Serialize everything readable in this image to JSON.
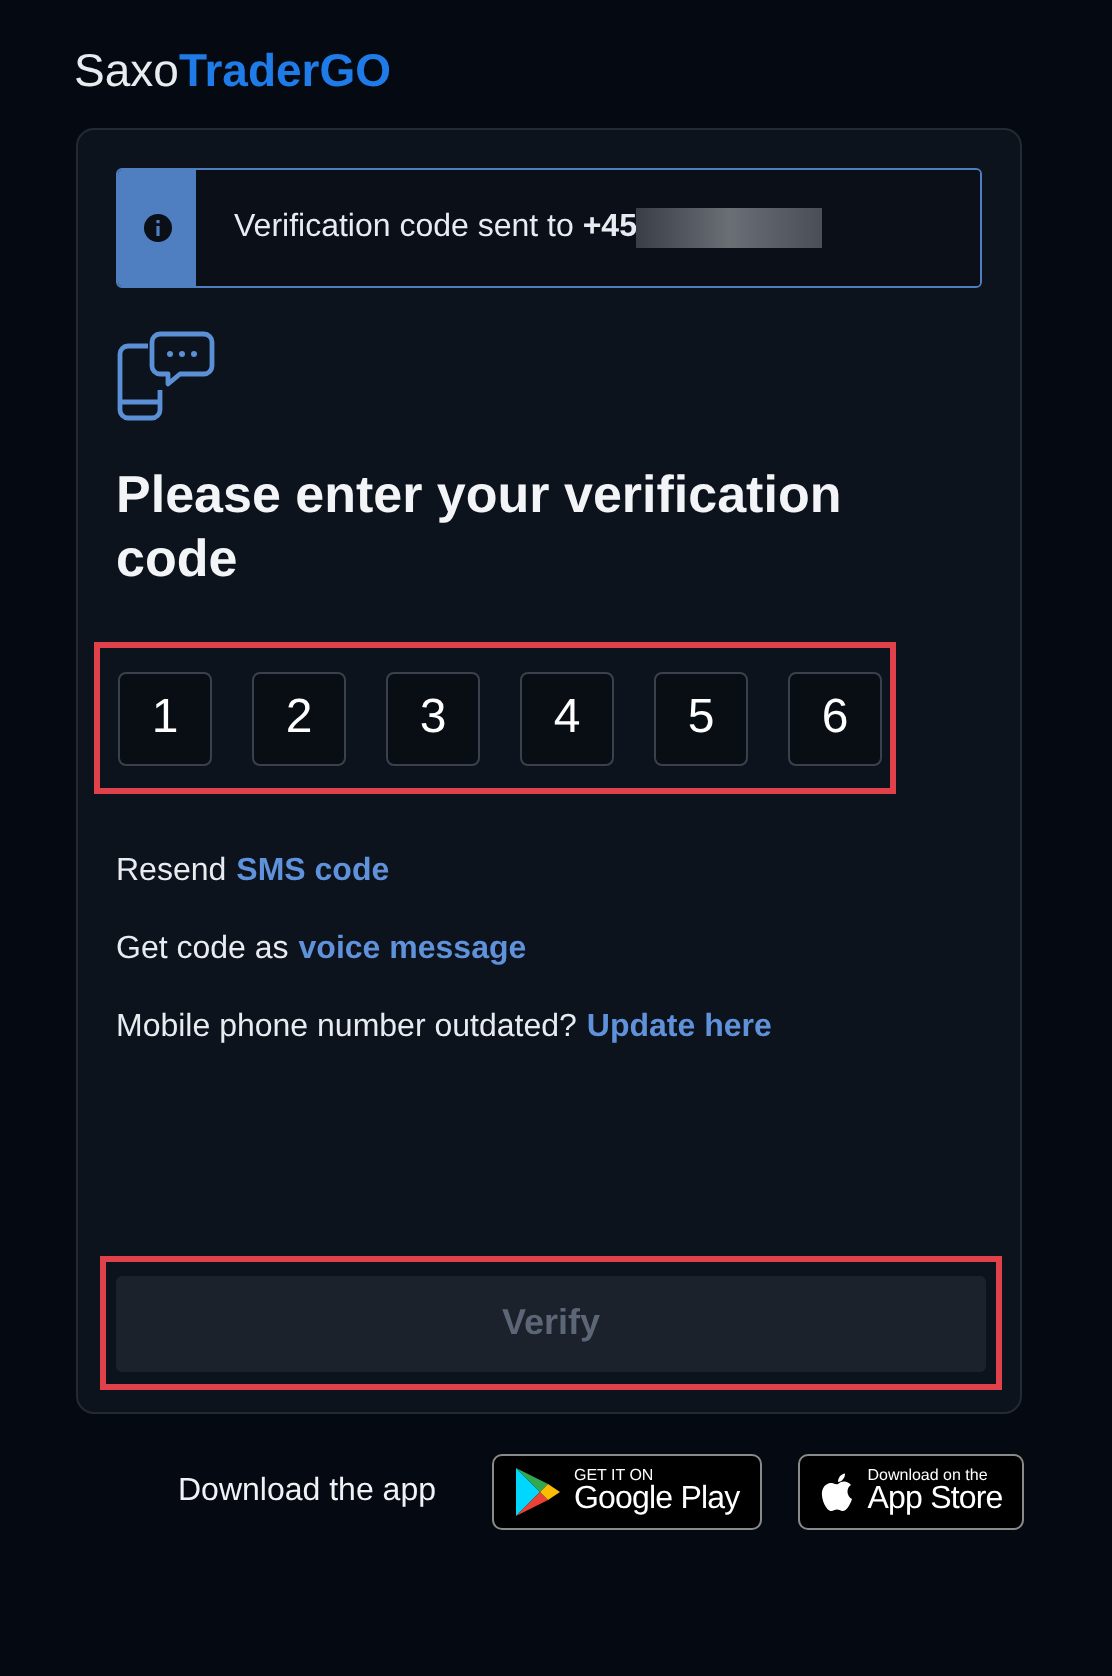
{
  "logo": {
    "brand": "Saxo",
    "product": "TraderGO"
  },
  "banner": {
    "text": "Verification code sent to **+45**",
    "redacted": true
  },
  "heading": "Please enter your verification code",
  "code": {
    "highlighted": true,
    "digits": [
      "1",
      "2",
      "3",
      "4",
      "5",
      "6"
    ]
  },
  "options": [
    {
      "text": "Resend",
      "link": "SMS code"
    },
    {
      "text": "Get code as",
      "link": "voice message"
    },
    {
      "text": "Mobile phone number outdated?",
      "link": "Update here"
    }
  ],
  "verify_button": {
    "label": "Verify",
    "disabled": true,
    "highlighted": true
  },
  "download": {
    "label": "Download the app",
    "badges": [
      {
        "kind": "google",
        "top": "GET IT ON",
        "bottom": "Google Play"
      },
      {
        "kind": "apple",
        "top": "Download on the",
        "bottom": "App Store"
      }
    ]
  }
}
